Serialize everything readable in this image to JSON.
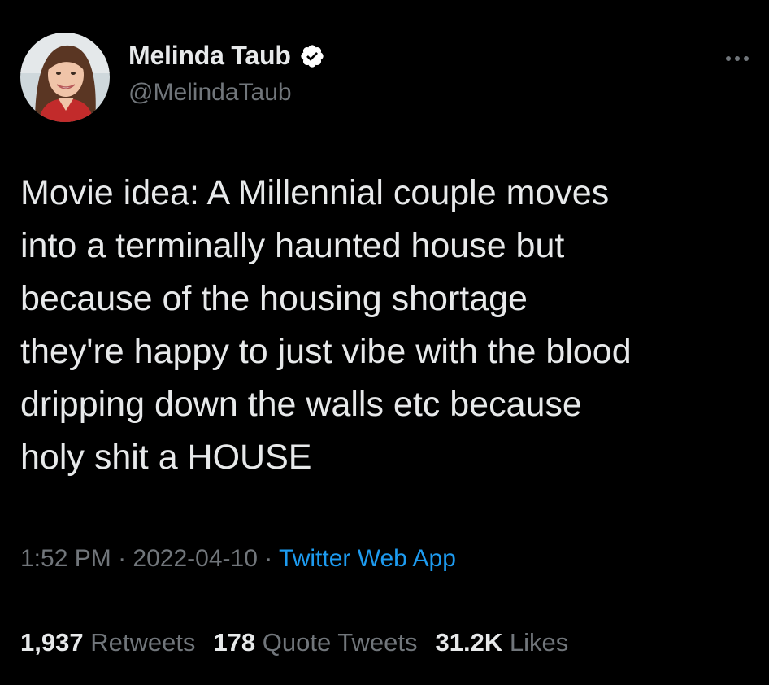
{
  "colors": {
    "background": "#000000",
    "primary_text": "#e7e9ea",
    "secondary_text": "#71767b",
    "link": "#1d9bf0",
    "verified_badge": "#ffffff",
    "divider": "#2f3336"
  },
  "author": {
    "display_name": "Melinda Taub",
    "handle": "@MelindaTaub",
    "verified": true,
    "avatar_icon": "profile-photo"
  },
  "more_menu_icon": "more-dots-icon",
  "tweet": {
    "lines": [
      "Movie idea: A Millennial couple moves",
      "into a terminally haunted house but",
      "because of the housing shortage",
      "they're happy to just vibe with the blood",
      "dripping down the walls etc because",
      "holy shit a HOUSE"
    ]
  },
  "meta": {
    "time": "1:52 PM",
    "separator": "·",
    "date": "2022-04-10",
    "source": "Twitter Web App"
  },
  "stats": {
    "retweets_count": "1,937",
    "retweets_label": "Retweets",
    "quotes_count": "178",
    "quotes_label": "Quote Tweets",
    "likes_count": "31.2K",
    "likes_label": "Likes"
  }
}
